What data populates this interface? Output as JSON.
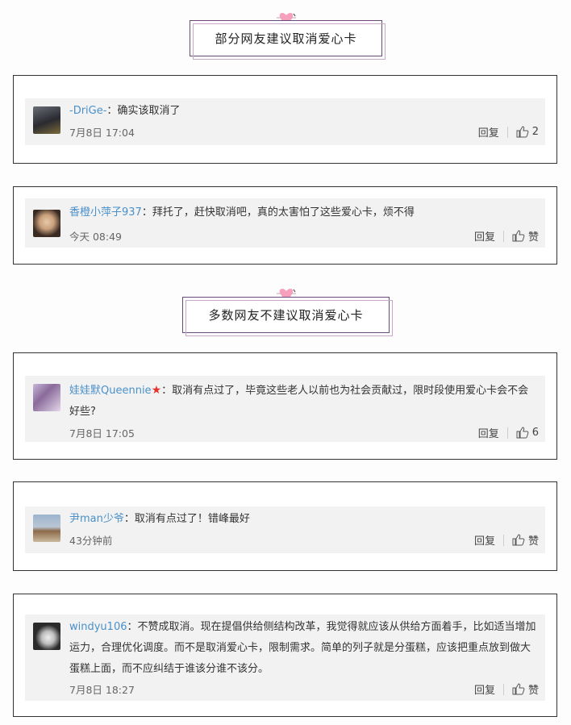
{
  "sections": [
    {
      "title": "部分网友建议取消爱心卡"
    },
    {
      "title": "多数网友不建议取消爱心卡"
    }
  ],
  "reply_label": "回复",
  "comments": [
    {
      "user": "-DriGe-",
      "sep": "：",
      "text": "确实该取消了",
      "time": "7月8日 17:04",
      "likes": "2"
    },
    {
      "user": "香橙小萍子937",
      "sep": "：",
      "text": "拜托了，赶快取消吧，真的太害怕了这些爱心卡，烦不得",
      "time": "今天 08:49",
      "likes": "赞"
    },
    {
      "user": "娃娃默Queennie",
      "sep": "：",
      "text": "取消有点过了，毕竟这些老人以前也为社会贡献过，限时段使用爱心卡会不会好些?",
      "time": "7月8日 17:05",
      "likes": "6"
    },
    {
      "user": "尹man少爷",
      "sep": "：",
      "text": "取消有点过了！错峰最好",
      "time": "43分钟前",
      "likes": "赞"
    },
    {
      "user": "windyu106",
      "sep": "：",
      "text": "不赞成取消。现在提倡供给侧结构改革，我觉得就应该从供给方面着手，比如适当增加运力，合理优化调度。而不是取消爱心卡，限制需求。简单的列子就是分蛋糕，应该把重点放到做大蛋糕上面，而不应纠结于谁该分谁不该分。",
      "time": "7月8日 18:27",
      "likes": "赞"
    }
  ],
  "colors": {
    "username": "#4a90c9",
    "panel": "#f2f2f2",
    "heart": "#f06b9a"
  }
}
